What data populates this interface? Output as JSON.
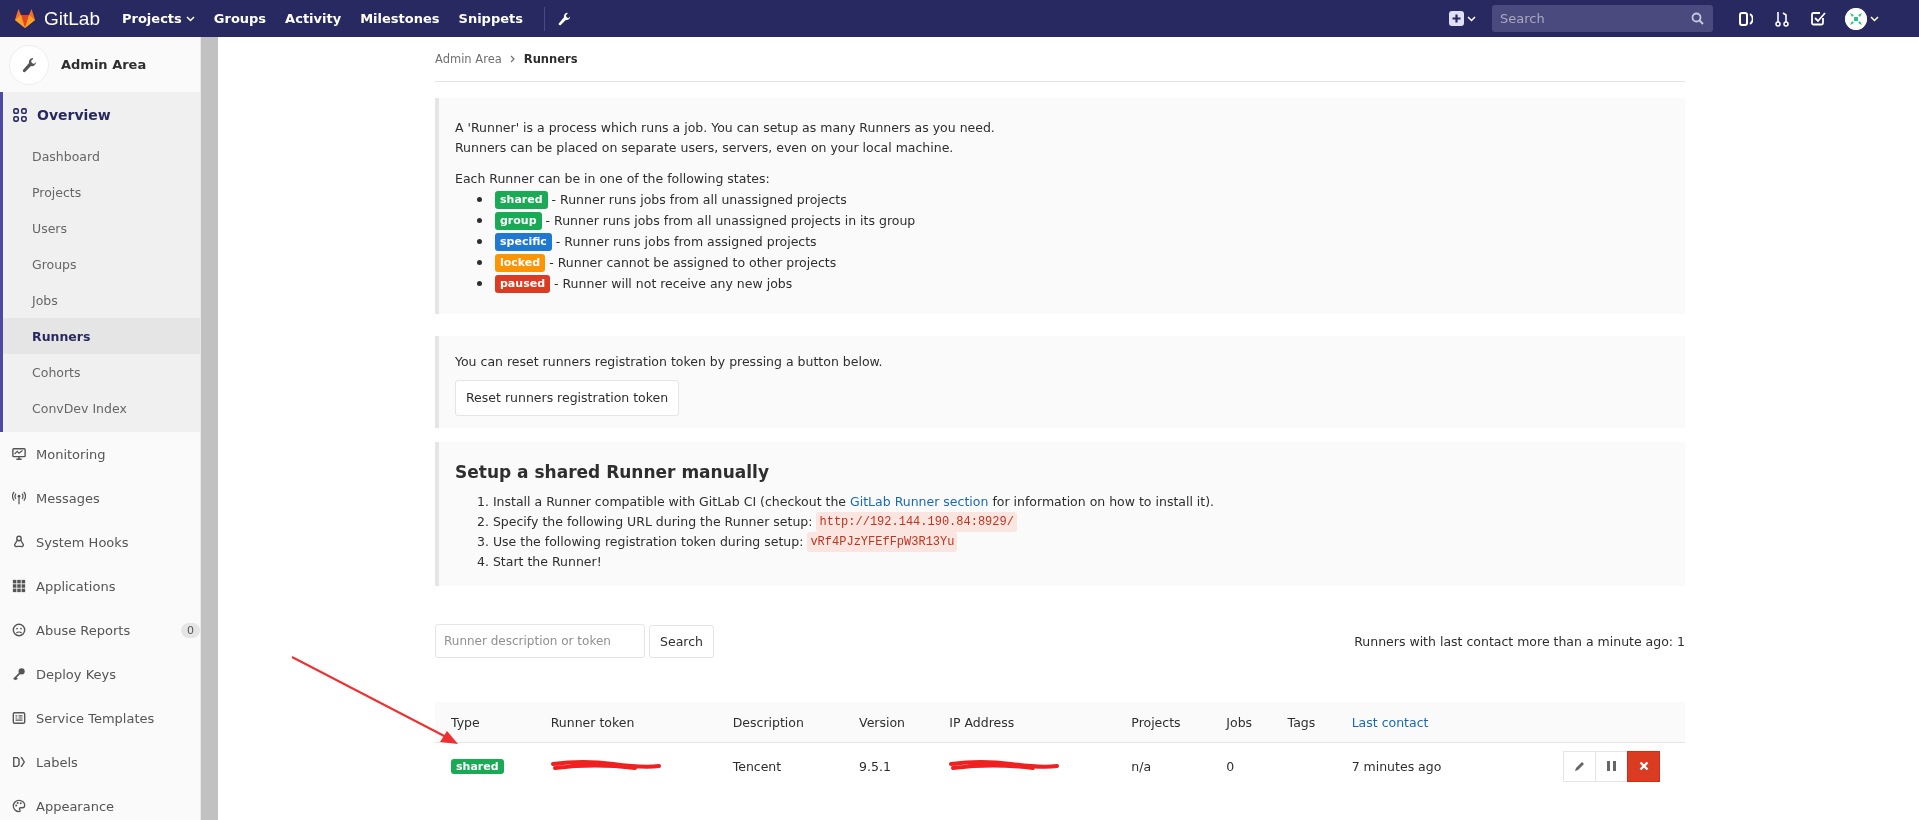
{
  "navbar": {
    "brand": "GitLab",
    "links": [
      {
        "label": "Projects",
        "dropdown": true
      },
      {
        "label": "Groups",
        "dropdown": false
      },
      {
        "label": "Activity",
        "dropdown": false
      },
      {
        "label": "Milestones",
        "dropdown": false
      },
      {
        "label": "Snippets",
        "dropdown": false
      }
    ],
    "search": {
      "placeholder": "Search"
    }
  },
  "sidebar": {
    "header": "Admin Area",
    "items": [
      {
        "label": "Overview",
        "selected": true,
        "children": [
          {
            "label": "Dashboard",
            "selected": false
          },
          {
            "label": "Projects",
            "selected": false
          },
          {
            "label": "Users",
            "selected": false
          },
          {
            "label": "Groups",
            "selected": false
          },
          {
            "label": "Jobs",
            "selected": false
          },
          {
            "label": "Runners",
            "selected": true
          },
          {
            "label": "Cohorts",
            "selected": false
          },
          {
            "label": "ConvDev Index",
            "selected": false
          }
        ]
      },
      {
        "label": "Monitoring",
        "selected": false
      },
      {
        "label": "Messages",
        "selected": false
      },
      {
        "label": "System Hooks",
        "selected": false
      },
      {
        "label": "Applications",
        "selected": false
      },
      {
        "label": "Abuse Reports",
        "selected": false,
        "badge": "0"
      },
      {
        "label": "Deploy Keys",
        "selected": false
      },
      {
        "label": "Service Templates",
        "selected": false
      },
      {
        "label": "Labels",
        "selected": false
      },
      {
        "label": "Appearance",
        "selected": false
      }
    ]
  },
  "breadcrumb": [
    "Admin Area",
    "Runners"
  ],
  "info": {
    "paragraph": [
      "A 'Runner' is a process which runs a job. You can setup as many Runners as you need.",
      "Runners can be placed on separate users, servers, even on your local machine."
    ],
    "states_intro": "Each Runner can be in one of the following states:",
    "states": [
      {
        "label": "shared",
        "color": "#1aaa55",
        "text": "- Runner runs jobs from all unassigned projects"
      },
      {
        "label": "group",
        "color": "#1aaa55",
        "text": "- Runner runs jobs from all unassigned projects in its group"
      },
      {
        "label": "specific",
        "color": "#1f78d1",
        "text": "- Runner runs jobs from assigned projects"
      },
      {
        "label": "locked",
        "color": "#fc9403",
        "text": "- Runner cannot be assigned to other projects"
      },
      {
        "label": "paused",
        "color": "#db3b21",
        "text": "- Runner will not receive any new jobs"
      }
    ]
  },
  "reset": {
    "text": "You can reset runners registration token by pressing a button below.",
    "button": "Reset runners registration token"
  },
  "setup": {
    "title": "Setup a shared Runner manually",
    "steps": [
      {
        "number": "1.",
        "before": "Install a Runner compatible with GitLab CI (checkout the",
        "link": "GitLab Runner section",
        "after": "for information on how to install it)."
      },
      {
        "number": "2.",
        "before": "Specify the following URL during the Runner setup:",
        "code": "http://192.144.190.84:8929/"
      },
      {
        "number": "3.",
        "before": "Use the following registration token during setup:",
        "code": "vRf4PJzYFEfFpW3R13Yu"
      },
      {
        "number": "4.",
        "before": "Start the Runner!"
      }
    ]
  },
  "filter": {
    "placeholder": "Runner description or token",
    "button": "Search",
    "status": "Runners with last contact more than a minute ago: 1"
  },
  "table": {
    "columns": [
      {
        "label": "Type",
        "kind": "text"
      },
      {
        "label": "Runner token",
        "kind": "text"
      },
      {
        "label": "Description",
        "kind": "text"
      },
      {
        "label": "Version",
        "kind": "text"
      },
      {
        "label": "IP Address",
        "kind": "text"
      },
      {
        "label": "Projects",
        "kind": "text"
      },
      {
        "label": "Jobs",
        "kind": "text"
      },
      {
        "label": "Tags",
        "kind": "text"
      },
      {
        "label": "Last contact",
        "kind": "link"
      }
    ],
    "rows": [
      {
        "cells": [
          {
            "kind": "label",
            "text": "shared",
            "color": "#1aaa55"
          },
          {
            "kind": "redacted"
          },
          {
            "kind": "text",
            "text": "Tencent"
          },
          {
            "kind": "text",
            "text": "9.5.1"
          },
          {
            "kind": "redacted"
          },
          {
            "kind": "text",
            "text": "n/a"
          },
          {
            "kind": "text",
            "text": "0"
          },
          {
            "kind": "text",
            "text": ""
          },
          {
            "kind": "text",
            "text": "7 minutes ago"
          }
        ],
        "actions": [
          {
            "kind": "edit"
          },
          {
            "kind": "pause"
          },
          {
            "kind": "remove"
          }
        ]
      }
    ]
  }
}
